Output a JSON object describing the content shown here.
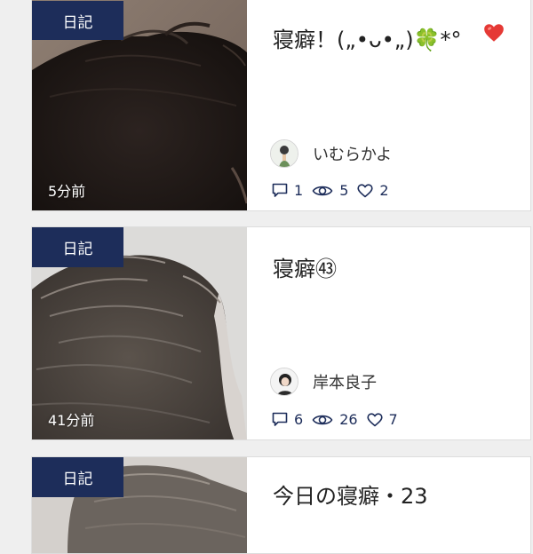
{
  "colors": {
    "badge": "#1d2d5a",
    "icon": "#1d2d5a",
    "heart_reaction": "#e53935"
  },
  "posts": [
    {
      "category": "日記",
      "time": "5分前",
      "title": "寝癖！(„•ᴗ•„)🍀*°",
      "reaction_icon": "red-heart-icon",
      "author": "いむらかよ",
      "comments": "1",
      "views": "5",
      "likes": "2"
    },
    {
      "category": "日記",
      "time": "41分前",
      "title": "寝癖㊸",
      "author": "岸本良子",
      "comments": "6",
      "views": "26",
      "likes": "7"
    },
    {
      "category": "日記",
      "title": "今日の寝癖・23"
    }
  ]
}
